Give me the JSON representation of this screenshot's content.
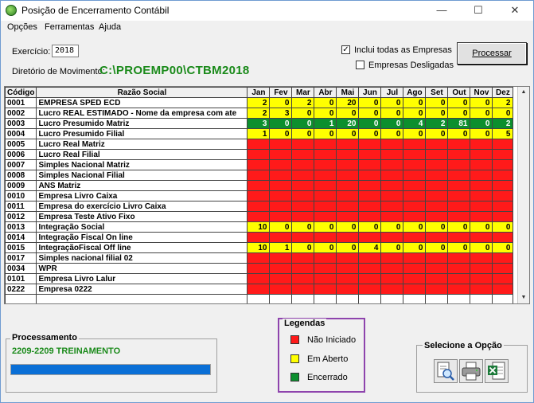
{
  "window": {
    "title": "Posição de Encerramento Contábil",
    "minimize": "—",
    "maximize": "☐",
    "close": "✕"
  },
  "menu": [
    {
      "label": "Opções"
    },
    {
      "label": "Ferramentas"
    },
    {
      "label": "Ajuda"
    }
  ],
  "form": {
    "exercicio_label": "Exercício:",
    "exercicio_value": "2018",
    "diretorio_label": "Diretório de Movimento:",
    "diretorio_value": "C:\\PROEMP00\\CTBM2018",
    "incluir_todas_label": "Inclui todas as Empresas",
    "incluir_todas_checked": true,
    "desligadas_label": "Empresas Desligadas",
    "desligadas_checked": false,
    "processar_label": "Processar"
  },
  "grid": {
    "headers": {
      "code": "Código",
      "name": "Razão Social",
      "months": [
        "Jan",
        "Fev",
        "Mar",
        "Abr",
        "Mai",
        "Jun",
        "Jul",
        "Ago",
        "Set",
        "Out",
        "Nov",
        "Dez"
      ]
    },
    "rows": [
      {
        "code": "0001",
        "name": "EMPRESA SPED ECD",
        "values": [
          "2",
          "0",
          "2",
          "0",
          "20",
          "0",
          "0",
          "0",
          "0",
          "0",
          "0",
          "2"
        ],
        "status": [
          "a",
          "a",
          "a",
          "a",
          "a",
          "a",
          "a",
          "a",
          "a",
          "a",
          "a",
          "a"
        ]
      },
      {
        "code": "0002",
        "name": "Lucro REAL ESTIMADO - Nome da empresa com ate",
        "values": [
          "2",
          "3",
          "0",
          "0",
          "0",
          "0",
          "0",
          "0",
          "0",
          "0",
          "0",
          "0"
        ],
        "status": [
          "a",
          "a",
          "a",
          "a",
          "a",
          "a",
          "a",
          "a",
          "a",
          "a",
          "a",
          "a"
        ]
      },
      {
        "code": "0003",
        "name": "Lucro Presumido Matriz",
        "values": [
          "3",
          "0",
          "0",
          "1",
          "20",
          "0",
          "0",
          "4",
          "2",
          "81",
          "0",
          "2"
        ],
        "status": [
          "e",
          "e",
          "e",
          "e",
          "e",
          "e",
          "e",
          "e",
          "e",
          "e",
          "e",
          "e"
        ]
      },
      {
        "code": "0004",
        "name": "Lucro Presumido Filial",
        "values": [
          "1",
          "0",
          "0",
          "0",
          "0",
          "0",
          "0",
          "0",
          "0",
          "0",
          "0",
          "5"
        ],
        "status": [
          "a",
          "a",
          "a",
          "a",
          "a",
          "a",
          "a",
          "a",
          "a",
          "a",
          "a",
          "a"
        ]
      },
      {
        "code": "0005",
        "name": "Lucro Real Matriz",
        "values": [
          "",
          "",
          "",
          "",
          "",
          "",
          "",
          "",
          "",
          "",
          "",
          ""
        ],
        "status": [
          "n",
          "n",
          "n",
          "n",
          "n",
          "n",
          "n",
          "n",
          "n",
          "n",
          "n",
          "n"
        ]
      },
      {
        "code": "0006",
        "name": "Lucro Real Filial",
        "values": [
          "",
          "",
          "",
          "",
          "",
          "",
          "",
          "",
          "",
          "",
          "",
          ""
        ],
        "status": [
          "n",
          "n",
          "n",
          "n",
          "n",
          "n",
          "n",
          "n",
          "n",
          "n",
          "n",
          "n"
        ]
      },
      {
        "code": "0007",
        "name": "Simples Nacional Matriz",
        "values": [
          "",
          "",
          "",
          "",
          "",
          "",
          "",
          "",
          "",
          "",
          "",
          ""
        ],
        "status": [
          "n",
          "n",
          "n",
          "n",
          "n",
          "n",
          "n",
          "n",
          "n",
          "n",
          "n",
          "n"
        ]
      },
      {
        "code": "0008",
        "name": "Simples Nacional Filial",
        "values": [
          "",
          "",
          "",
          "",
          "",
          "",
          "",
          "",
          "",
          "",
          "",
          ""
        ],
        "status": [
          "n",
          "n",
          "n",
          "n",
          "n",
          "n",
          "n",
          "n",
          "n",
          "n",
          "n",
          "n"
        ]
      },
      {
        "code": "0009",
        "name": "ANS Matriz",
        "values": [
          "",
          "",
          "",
          "",
          "",
          "",
          "",
          "",
          "",
          "",
          "",
          ""
        ],
        "status": [
          "n",
          "n",
          "n",
          "n",
          "n",
          "n",
          "n",
          "n",
          "n",
          "n",
          "n",
          "n"
        ]
      },
      {
        "code": "0010",
        "name": "Empresa Livro Caixa",
        "values": [
          "",
          "",
          "",
          "",
          "",
          "",
          "",
          "",
          "",
          "",
          "",
          ""
        ],
        "status": [
          "n",
          "n",
          "n",
          "n",
          "n",
          "n",
          "n",
          "n",
          "n",
          "n",
          "n",
          "n"
        ]
      },
      {
        "code": "0011",
        "name": "Empresa do exercício Livro Caixa",
        "values": [
          "",
          "",
          "",
          "",
          "",
          "",
          "",
          "",
          "",
          "",
          "",
          ""
        ],
        "status": [
          "n",
          "n",
          "n",
          "n",
          "n",
          "n",
          "n",
          "n",
          "n",
          "n",
          "n",
          "n"
        ]
      },
      {
        "code": "0012",
        "name": "Empresa Teste Ativo Fixo",
        "values": [
          "",
          "",
          "",
          "",
          "",
          "",
          "",
          "",
          "",
          "",
          "",
          ""
        ],
        "status": [
          "n",
          "n",
          "n",
          "n",
          "n",
          "n",
          "n",
          "n",
          "n",
          "n",
          "n",
          "n"
        ]
      },
      {
        "code": "0013",
        "name": "Integração Social",
        "values": [
          "10",
          "0",
          "0",
          "0",
          "0",
          "0",
          "0",
          "0",
          "0",
          "0",
          "0",
          "0"
        ],
        "status": [
          "a",
          "a",
          "a",
          "a",
          "a",
          "a",
          "a",
          "a",
          "a",
          "a",
          "a",
          "a"
        ]
      },
      {
        "code": "0014",
        "name": "Integração Fiscal On line",
        "values": [
          "",
          "",
          "",
          "",
          "",
          "",
          "",
          "",
          "",
          "",
          "",
          ""
        ],
        "status": [
          "n",
          "n",
          "n",
          "n",
          "n",
          "n",
          "n",
          "n",
          "n",
          "n",
          "n",
          "n"
        ]
      },
      {
        "code": "0015",
        "name": "IntegraçãoFiscal Off line",
        "values": [
          "10",
          "1",
          "0",
          "0",
          "0",
          "4",
          "0",
          "0",
          "0",
          "0",
          "0",
          "0"
        ],
        "status": [
          "a",
          "a",
          "a",
          "a",
          "a",
          "a",
          "a",
          "a",
          "a",
          "a",
          "a",
          "a"
        ]
      },
      {
        "code": "0017",
        "name": "Simples nacional filial 02",
        "values": [
          "",
          "",
          "",
          "",
          "",
          "",
          "",
          "",
          "",
          "",
          "",
          ""
        ],
        "status": [
          "n",
          "n",
          "n",
          "n",
          "n",
          "n",
          "n",
          "n",
          "n",
          "n",
          "n",
          "n"
        ]
      },
      {
        "code": "0034",
        "name": "WPR",
        "values": [
          "",
          "",
          "",
          "",
          "",
          "",
          "",
          "",
          "",
          "",
          "",
          ""
        ],
        "status": [
          "n",
          "n",
          "n",
          "n",
          "n",
          "n",
          "n",
          "n",
          "n",
          "n",
          "n",
          "n"
        ]
      },
      {
        "code": "0101",
        "name": "Empresa Livro Lalur",
        "values": [
          "",
          "",
          "",
          "",
          "",
          "",
          "",
          "",
          "",
          "",
          "",
          ""
        ],
        "status": [
          "n",
          "n",
          "n",
          "n",
          "n",
          "n",
          "n",
          "n",
          "n",
          "n",
          "n",
          "n"
        ]
      },
      {
        "code": "0222",
        "name": "Empresa 0222",
        "values": [
          "",
          "",
          "",
          "",
          "",
          "",
          "",
          "",
          "",
          "",
          "",
          ""
        ],
        "status": [
          "n",
          "n",
          "n",
          "n",
          "n",
          "n",
          "n",
          "n",
          "n",
          "n",
          "n",
          "n"
        ]
      },
      {
        "code": "",
        "name": "",
        "values": [
          "",
          "",
          "",
          "",
          "",
          "",
          "",
          "",
          "",
          "",
          "",
          ""
        ],
        "status": [
          "w",
          "w",
          "w",
          "w",
          "w",
          "w",
          "w",
          "w",
          "w",
          "w",
          "w",
          "w"
        ]
      }
    ]
  },
  "processamento": {
    "title": "Processamento",
    "status_text": "2209-2209 TREINAMENTO",
    "progress": 1.0
  },
  "legendas": {
    "title": "Legendas",
    "items": [
      {
        "label": "Não Iniciado",
        "color": "#ff1a1a"
      },
      {
        "label": "Em Aberto",
        "color": "#ffff00"
      },
      {
        "label": "Encerrado",
        "color": "#0c8f2e"
      }
    ]
  },
  "opcao": {
    "title": "Selecione a Opção",
    "buttons": [
      "preview-icon",
      "printer-icon",
      "excel-icon"
    ]
  }
}
